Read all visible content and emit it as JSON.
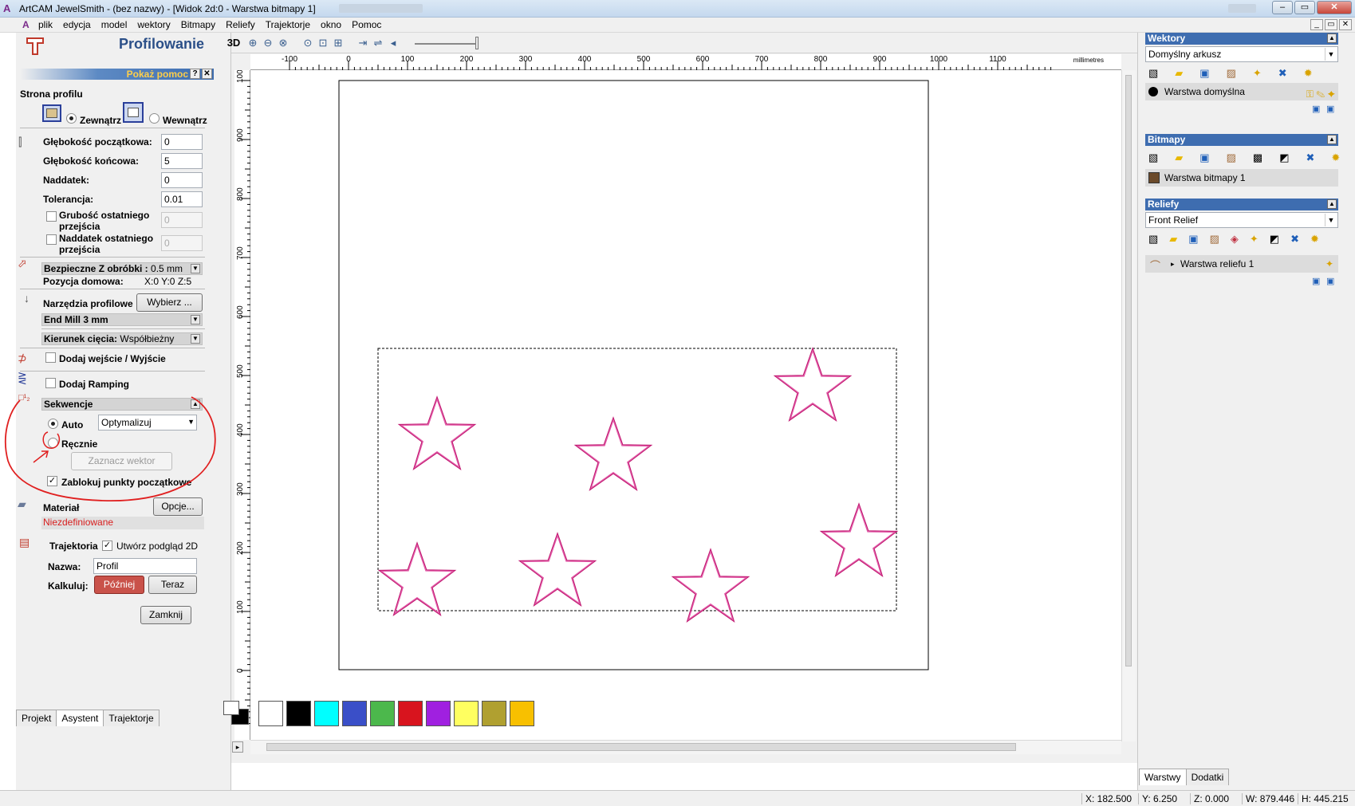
{
  "window": {
    "title": "ArtCAM JewelSmith - (bez nazwy) - [Widok 2d:0 - Warstwa bitmapy 1]"
  },
  "menu": {
    "items": [
      "plik",
      "edycja",
      "model",
      "wektory",
      "Bitmapy",
      "Reliefy",
      "Trajektorje",
      "okno",
      "Pomoc"
    ]
  },
  "panel": {
    "title": "Profilowanie",
    "help_label": "Pokaż pomoc",
    "help_q": "?",
    "help_x": "✕",
    "strona_label": "Strona profilu",
    "zewnatrz": "Zewnątrz",
    "wewnatrz": "Wewnątrz",
    "glebokosc_pocz_label": "Głębokość początkowa:",
    "glebokosc_pocz_value": "0",
    "glebokosc_konc_label": "Głębokość końcowa:",
    "glebokosc_konc_value": "5",
    "naddatek_label": "Naddatek:",
    "naddatek_value": "0",
    "tolerancja_label": "Tolerancja:",
    "tolerancja_value": "0.01",
    "grubosc_label1": "Grubość ostatniego",
    "grubosc_label2": "przejścia",
    "grubosc_value": "0",
    "naddatek_ost_label1": "Naddatek ostatniego",
    "naddatek_ost_label2": "przejścia",
    "naddatek_ost_value": "0",
    "bezpieczne_label": "Bezpieczne Z obróbki :",
    "bezpieczne_value": "0.5 mm",
    "pozycja_label": "Pozycja domowa:",
    "pozycja_value": "X:0 Y:0 Z:5",
    "narzedzia_label": "Narzędzia profilowe",
    "wybierz": "Wybierz ...",
    "tool": "End Mill 3 mm",
    "kierunek_label": "Kierunek cięcia:",
    "kierunek_value": "Współbieżny",
    "dodaj_wejscie": "Dodaj wejście / Wyjście",
    "dodaj_ramping": "Dodaj Ramping",
    "sekwencje": "Sekwencje",
    "auto": "Auto",
    "auto_option": "Optymalizuj",
    "recznie": "Ręcznie",
    "zaznacz": "Zaznacz wektor",
    "zablokuj": "Zablokuj punkty początkowe",
    "material": "Materiał",
    "opcje": "Opcje...",
    "niezdefiniowane": "Niezdefiniowane",
    "trajektoria": "Trajektoria",
    "utworz": "Utwórz podgląd 2D",
    "nazwa_label": "Nazwa:",
    "nazwa_value": "Profil",
    "kalkuluj_label": "Kalkuluj:",
    "pozniej": "Później",
    "teraz": "Teraz",
    "zamknij": "Zamknij",
    "accent_red": "#c9524a",
    "annotation_color": "#e02020"
  },
  "lefttabs": [
    "Projekt",
    "Asystent",
    "Trajektorje"
  ],
  "toolbar": {
    "view3d": "3D",
    "units": "millimetres"
  },
  "ruler": {
    "h": [
      "-100",
      "0",
      "100",
      "200",
      "300",
      "400",
      "500",
      "600",
      "700",
      "800",
      "900",
      "1000",
      "1100"
    ],
    "v": [
      "1000",
      "900",
      "800",
      "700",
      "600",
      "500",
      "400",
      "300",
      "200",
      "100",
      "0"
    ]
  },
  "palette": [
    "#ffffff",
    "#000000",
    "#00ffff",
    "#3a4fc8",
    "#4cb84c",
    "#d8141e",
    "#a020e0",
    "#ffff60",
    "#b0a030",
    "#f8c000"
  ],
  "right": {
    "wektory": "Wektory",
    "wektory_select": "Domyślny arkusz",
    "wektory_layer": "Warstwa domyślna",
    "bitmapy": "Bitmapy",
    "bitmapy_layer": "Warstwa bitmapy 1",
    "reliefy": "Reliefy",
    "reliefy_select": "Front Relief",
    "reliefy_layer": "Warstwa reliefu 1",
    "tabs": [
      "Warstwy",
      "Dodatki"
    ]
  },
  "status": {
    "x": "X: 182.500",
    "y": "Y: 6.250",
    "z": "Z: 0.000",
    "w": "W: 879.446",
    "h": "H: 445.215"
  },
  "star_color": "#d81b7a"
}
